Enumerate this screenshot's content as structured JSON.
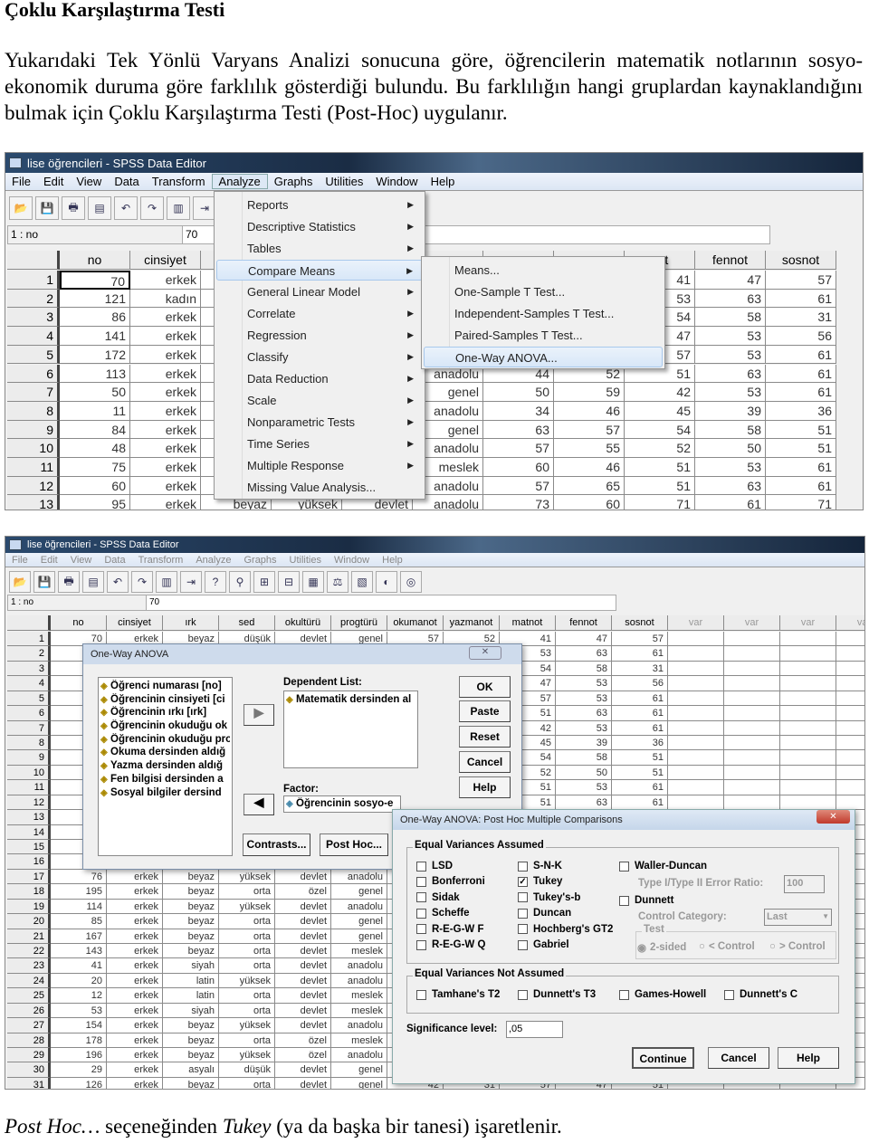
{
  "heading": "Çoklu Karşılaştırma Testi",
  "paragraph": "Yukarıdaki Tek Yönlü Varyans Analizi sonucuna göre, öğrencilerin matematik notlarının sosyo-ekonomik duruma göre farklılık gösterdiği bulundu. Bu farklılığın hangi gruplardan kaynaklandığını bulmak için Çoklu Karşılaştırma Testi (Post-Hoc) uygulanır.",
  "caption": {
    "part1": "Post Hoc…",
    "part2": " seçeneğinden ",
    "part3": "Tukey",
    "part4": " (ya da başka bir tanesi) işaretlenir."
  },
  "shot1": {
    "title": "lise öğrencileri - SPSS Data Editor",
    "menu": [
      "File",
      "Edit",
      "View",
      "Data",
      "Transform",
      "Analyze",
      "Graphs",
      "Utilities",
      "Window",
      "Help"
    ],
    "cell_ref": "1 : no",
    "cell_value": "70",
    "columns": [
      "no",
      "cinsiyet",
      "",
      "",
      "",
      "",
      "",
      "",
      "not",
      "fennot",
      "sosnot"
    ],
    "rows": [
      [
        "70",
        "erkek",
        "",
        "",
        "",
        "",
        "",
        "",
        "41",
        "47",
        "57"
      ],
      [
        "121",
        "kadın",
        "",
        "",
        "",
        "",
        "",
        "",
        "53",
        "63",
        "61"
      ],
      [
        "86",
        "erkek",
        "",
        "",
        "",
        "",
        "",
        "",
        "54",
        "58",
        "31"
      ],
      [
        "141",
        "erkek",
        "",
        "",
        "",
        "",
        "",
        "",
        "47",
        "53",
        "56"
      ],
      [
        "172",
        "erkek",
        "",
        "",
        "",
        "",
        "",
        "",
        "57",
        "53",
        "61"
      ],
      [
        "113",
        "erkek",
        "",
        "",
        "",
        "anadolu",
        "44",
        "52",
        "51",
        "63",
        "61"
      ],
      [
        "50",
        "erkek",
        "",
        "",
        "",
        "genel",
        "50",
        "59",
        "42",
        "53",
        "61"
      ],
      [
        "11",
        "erkek",
        "",
        "",
        "",
        "anadolu",
        "34",
        "46",
        "45",
        "39",
        "36"
      ],
      [
        "84",
        "erkek",
        "",
        "",
        "",
        "genel",
        "63",
        "57",
        "54",
        "58",
        "51"
      ],
      [
        "48",
        "erkek",
        "",
        "",
        "",
        "anadolu",
        "57",
        "55",
        "52",
        "50",
        "51"
      ],
      [
        "75",
        "erkek",
        "",
        "",
        "",
        "meslek",
        "60",
        "46",
        "51",
        "53",
        "61"
      ],
      [
        "60",
        "erkek",
        "",
        "",
        "",
        "anadolu",
        "57",
        "65",
        "51",
        "63",
        "61"
      ],
      [
        "95",
        "erkek",
        "beyaz",
        "yüksek",
        "devlet",
        "anadolu",
        "73",
        "60",
        "71",
        "61",
        "71"
      ]
    ],
    "analyze_menu": [
      "Reports",
      "Descriptive Statistics",
      "Tables",
      "Compare Means",
      "General Linear Model",
      "Correlate",
      "Regression",
      "Classify",
      "Data Reduction",
      "Scale",
      "Nonparametric Tests",
      "Time Series",
      "Multiple Response",
      "Missing Value Analysis..."
    ],
    "analyze_menu_highlighted": "Compare Means",
    "compare_means_menu": [
      "Means...",
      "One-Sample T Test...",
      "Independent-Samples T Test...",
      "Paired-Samples T Test...",
      "One-Way ANOVA..."
    ],
    "compare_means_highlighted": "One-Way ANOVA..."
  },
  "shot2": {
    "title": "lise öğrencileri - SPSS Data Editor",
    "menu": [
      "File",
      "Edit",
      "View",
      "Data",
      "Transform",
      "Analyze",
      "Graphs",
      "Utilities",
      "Window",
      "Help"
    ],
    "cell_ref": "1 : no",
    "cell_value": "70",
    "columns": [
      "no",
      "cinsiyet",
      "ırk",
      "sed",
      "okultürü",
      "progtürü",
      "okumanot",
      "yazmanot",
      "matnot",
      "fennot",
      "sosnot",
      "var",
      "var",
      "var",
      "var"
    ],
    "rows": [
      [
        "70",
        "erkek",
        "beyaz",
        "düşük",
        "devlet",
        "genel",
        "57",
        "52",
        "41",
        "47",
        "57"
      ],
      [
        "",
        "",
        "",
        "",
        "",
        "",
        "",
        "",
        "53",
        "63",
        "61"
      ],
      [
        "",
        "",
        "",
        "",
        "",
        "",
        "",
        "",
        "54",
        "58",
        "31"
      ],
      [
        "",
        "",
        "",
        "",
        "",
        "",
        "",
        "",
        "47",
        "53",
        "56"
      ],
      [
        "",
        "",
        "",
        "",
        "",
        "",
        "",
        "",
        "57",
        "53",
        "61"
      ],
      [
        "",
        "",
        "",
        "",
        "",
        "",
        "",
        "",
        "51",
        "63",
        "61"
      ],
      [
        "",
        "",
        "",
        "",
        "",
        "",
        "",
        "",
        "42",
        "53",
        "61"
      ],
      [
        "",
        "",
        "",
        "",
        "",
        "",
        "",
        "",
        "45",
        "39",
        "36"
      ],
      [
        "",
        "",
        "",
        "",
        "",
        "",
        "",
        "",
        "54",
        "58",
        "51"
      ],
      [
        "",
        "",
        "",
        "",
        "",
        "",
        "",
        "",
        "52",
        "50",
        "51"
      ],
      [
        "",
        "",
        "",
        "",
        "",
        "",
        "",
        "",
        "51",
        "53",
        "61"
      ],
      [
        "",
        "",
        "",
        "",
        "",
        "",
        "",
        "",
        "51",
        "63",
        "61"
      ],
      [
        "",
        "",
        "",
        "",
        "",
        "",
        "",
        "",
        "",
        "",
        ""
      ],
      [
        "",
        "",
        "",
        "",
        "",
        "",
        "",
        "",
        "",
        "",
        ""
      ],
      [
        "",
        "",
        "",
        "",
        "",
        "",
        "",
        "",
        "",
        "",
        ""
      ],
      [
        "",
        "",
        "",
        "",
        "",
        "",
        "",
        "",
        "",
        "",
        ""
      ],
      [
        "76",
        "erkek",
        "beyaz",
        "yüksek",
        "devlet",
        "anadolu",
        "",
        "",
        "",
        "",
        ""
      ],
      [
        "195",
        "erkek",
        "beyaz",
        "orta",
        "özel",
        "genel",
        "",
        "",
        "",
        "",
        ""
      ],
      [
        "114",
        "erkek",
        "beyaz",
        "yüksek",
        "devlet",
        "anadolu",
        "",
        "",
        "",
        "",
        ""
      ],
      [
        "85",
        "erkek",
        "beyaz",
        "orta",
        "devlet",
        "genel",
        "",
        "",
        "",
        "",
        ""
      ],
      [
        "167",
        "erkek",
        "beyaz",
        "orta",
        "devlet",
        "genel",
        "",
        "",
        "",
        "",
        ""
      ],
      [
        "143",
        "erkek",
        "beyaz",
        "orta",
        "devlet",
        "meslek",
        "",
        "",
        "",
        "",
        ""
      ],
      [
        "41",
        "erkek",
        "siyah",
        "orta",
        "devlet",
        "anadolu",
        "",
        "",
        "",
        "",
        ""
      ],
      [
        "20",
        "erkek",
        "latin",
        "yüksek",
        "devlet",
        "anadolu",
        "",
        "",
        "",
        "",
        ""
      ],
      [
        "12",
        "erkek",
        "latin",
        "orta",
        "devlet",
        "meslek",
        "",
        "",
        "",
        "",
        ""
      ],
      [
        "53",
        "erkek",
        "siyah",
        "orta",
        "devlet",
        "meslek",
        "",
        "",
        "",
        "",
        ""
      ],
      [
        "154",
        "erkek",
        "beyaz",
        "yüksek",
        "devlet",
        "anadolu",
        "",
        "",
        "",
        "",
        ""
      ],
      [
        "178",
        "erkek",
        "beyaz",
        "orta",
        "özel",
        "meslek",
        "",
        "",
        "",
        "",
        ""
      ],
      [
        "196",
        "erkek",
        "beyaz",
        "yüksek",
        "özel",
        "anadolu",
        "",
        "",
        "",
        "",
        ""
      ],
      [
        "29",
        "erkek",
        "asyalı",
        "düşük",
        "devlet",
        "genel",
        "",
        "",
        "",
        "",
        ""
      ],
      [
        "126",
        "erkek",
        "beyaz",
        "orta",
        "devlet",
        "genel",
        "42",
        "31",
        "57",
        "47",
        "51"
      ]
    ],
    "anova_dialog": {
      "title": "One-Way ANOVA",
      "variables": [
        "Öğrenci numarası [no]",
        "Öğrencinin cinsiyeti [ci",
        "Öğrencinin ırkı [ırk]",
        "Öğrencinin okuduğu ok",
        "Öğrencinin okuduğu pro",
        "Okuma dersinden aldığ",
        "Yazma dersinden aldığ",
        "Fen bilgisi dersinden a",
        "Sosyal bilgiler dersind"
      ],
      "dependent_label": "Dependent List:",
      "dependent_value": "Matematik dersinden al",
      "factor_label": "Factor:",
      "factor_value": "Öğrencinin sosyo-e",
      "buttons": {
        "ok": "OK",
        "paste": "Paste",
        "reset": "Reset",
        "cancel": "Cancel",
        "help": "Help",
        "contrasts": "Contrasts...",
        "posthoc": "Post Hoc..."
      }
    },
    "posthoc_dialog": {
      "title": "One-Way ANOVA: Post Hoc Multiple Comparisons",
      "equal_assumed_label": "Equal Variances Assumed",
      "equal_assumed": [
        {
          "label": "LSD",
          "checked": false
        },
        {
          "label": "Bonferroni",
          "checked": false
        },
        {
          "label": "Sidak",
          "checked": false
        },
        {
          "label": "Scheffe",
          "checked": false
        },
        {
          "label": "R-E-G-W F",
          "checked": false
        },
        {
          "label": "R-E-G-W Q",
          "checked": false
        },
        {
          "label": "S-N-K",
          "checked": false
        },
        {
          "label": "Tukey",
          "checked": true
        },
        {
          "label": "Tukey's-b",
          "checked": false
        },
        {
          "label": "Duncan",
          "checked": false
        },
        {
          "label": "Hochberg's GT2",
          "checked": false
        },
        {
          "label": "Gabriel",
          "checked": false
        }
      ],
      "waller_duncan": {
        "label": "Waller-Duncan",
        "checked": false
      },
      "error_ratio_label": "Type I/Type II Error Ratio:",
      "error_ratio_value": "100",
      "dunnett": {
        "label": "Dunnett",
        "checked": false
      },
      "control_category_label": "Control Category:",
      "control_category_value": "Last",
      "test_label": "Test",
      "test_options": [
        {
          "label": "2-sided",
          "selected": true
        },
        {
          "label": "< Control",
          "selected": false
        },
        {
          "label": "> Control",
          "selected": false
        }
      ],
      "not_assumed_label": "Equal Variances Not Assumed",
      "not_assumed": [
        {
          "label": "Tamhane's T2",
          "checked": false
        },
        {
          "label": "Dunnett's T3",
          "checked": false
        },
        {
          "label": "Games-Howell",
          "checked": false
        },
        {
          "label": "Dunnett's C",
          "checked": false
        }
      ],
      "significance_label": "Significance level:",
      "significance_value": ",05",
      "buttons": {
        "continue": "Continue",
        "cancel": "Cancel",
        "help": "Help"
      }
    }
  }
}
